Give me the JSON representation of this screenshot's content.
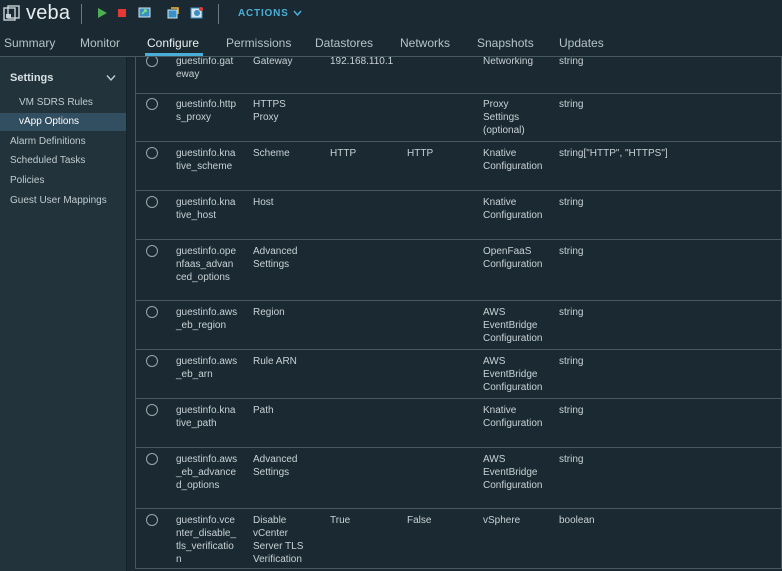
{
  "header": {
    "vm_name": "veba",
    "actions_label": "ACTIONS",
    "tools": [
      "power-on-icon",
      "power-off-icon",
      "console-icon",
      "migrate-icon",
      "snapshot-icon"
    ]
  },
  "tabs": [
    {
      "label": "Summary",
      "active": false
    },
    {
      "label": "Monitor",
      "active": false
    },
    {
      "label": "Configure",
      "active": true
    },
    {
      "label": "Permissions",
      "active": false
    },
    {
      "label": "Datastores",
      "active": false
    },
    {
      "label": "Networks",
      "active": false
    },
    {
      "label": "Snapshots",
      "active": false
    },
    {
      "label": "Updates",
      "active": false
    }
  ],
  "sidebar": {
    "heading": "Settings",
    "items": [
      {
        "label": "VM SDRS Rules",
        "level": "sub",
        "selected": false
      },
      {
        "label": "vApp Options",
        "level": "sub",
        "selected": true
      },
      {
        "label": "Alarm Definitions",
        "level": "top",
        "selected": false
      },
      {
        "label": "Scheduled Tasks",
        "level": "top",
        "selected": false
      },
      {
        "label": "Policies",
        "level": "top",
        "selected": false
      },
      {
        "label": "Guest User Mappings",
        "level": "top",
        "selected": false
      }
    ]
  },
  "table": {
    "rows": [
      {
        "key": "guestinfo.gateway",
        "label": "Gateway",
        "default": "192.168.110.1",
        "value": "",
        "category": "Networking",
        "type": "string"
      },
      {
        "key": "guestinfo.https_proxy",
        "label": "HTTPS Proxy",
        "default": "",
        "value": "",
        "category": "Proxy Settings (optional)",
        "type": "string"
      },
      {
        "key": "guestinfo.knative_scheme",
        "label": "Scheme",
        "default": "HTTP",
        "value": "HTTP",
        "category": "Knative Configuration",
        "type": "string[\"HTTP\", \"HTTPS\"]"
      },
      {
        "key": "guestinfo.knative_host",
        "label": "Host",
        "default": "",
        "value": "",
        "category": "Knative Configuration",
        "type": "string"
      },
      {
        "key": "guestinfo.openfaas_advanced_options",
        "label": "Advanced Settings",
        "default": "",
        "value": "",
        "category": "OpenFaaS Configuration",
        "type": "string"
      },
      {
        "key": "guestinfo.aws_eb_region",
        "label": "Region",
        "default": "",
        "value": "",
        "category": "AWS EventBridge Configuration",
        "type": "string"
      },
      {
        "key": "guestinfo.aws_eb_arn",
        "label": "Rule ARN",
        "default": "",
        "value": "",
        "category": "AWS EventBridge Configuration",
        "type": "string"
      },
      {
        "key": "guestinfo.knative_path",
        "label": "Path",
        "default": "",
        "value": "",
        "category": "Knative Configuration",
        "type": "string"
      },
      {
        "key": "guestinfo.aws_eb_advanced_options",
        "label": "Advanced Settings",
        "default": "",
        "value": "",
        "category": "AWS EventBridge Configuration",
        "type": "string"
      },
      {
        "key": "guestinfo.vcenter_disable_tls_verification",
        "label": "Disable vCenter Server TLS Verification",
        "default": "True",
        "value": "False",
        "category": "vSphere",
        "type": "boolean"
      }
    ]
  },
  "colors": {
    "accent": "#49afd9",
    "background": "#1b2a32",
    "sidebar": "#22333b",
    "selected": "#324f61"
  }
}
